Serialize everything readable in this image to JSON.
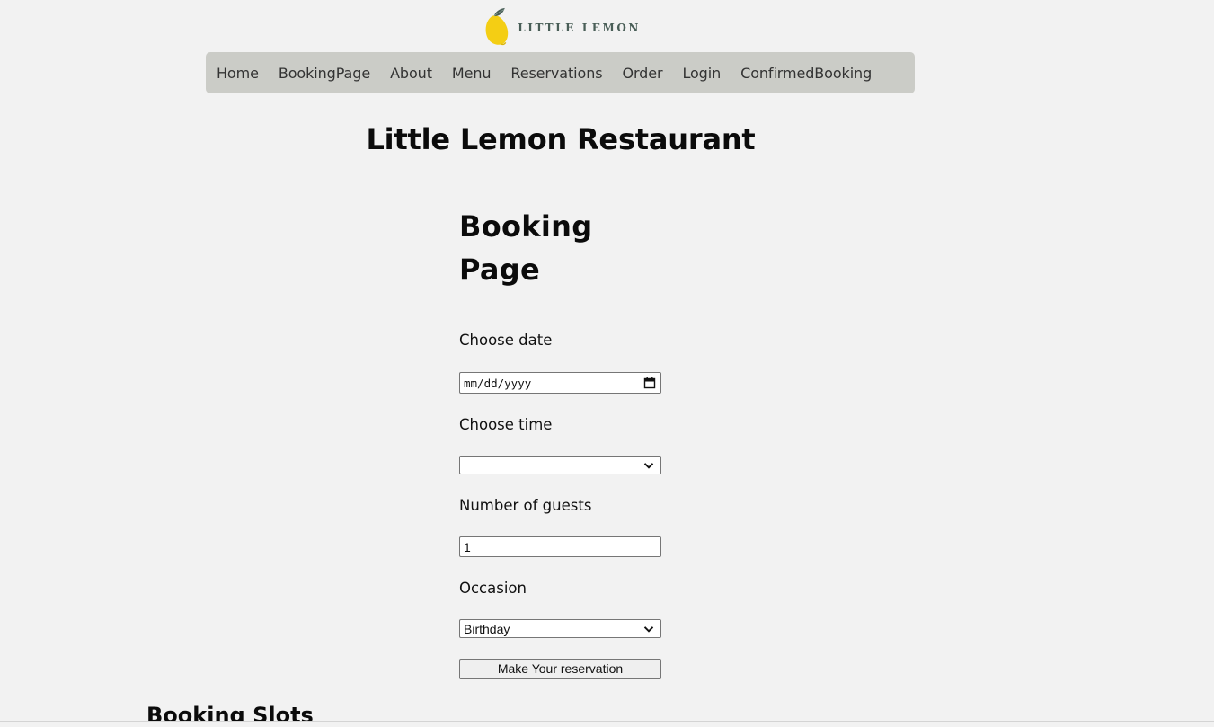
{
  "logo": {
    "text": "LITTLE LEMON",
    "icon": "lemon-icon",
    "colors": {
      "lemon": "#f4ce14",
      "leaf": "#495e57",
      "text": "#495e57"
    }
  },
  "nav": {
    "items": [
      {
        "label": "Home"
      },
      {
        "label": "BookingPage"
      },
      {
        "label": "About"
      },
      {
        "label": "Menu"
      },
      {
        "label": "Reservations"
      },
      {
        "label": "Order"
      },
      {
        "label": "Login"
      },
      {
        "label": "ConfirmedBooking"
      }
    ]
  },
  "header": {
    "title": "Little Lemon Restaurant"
  },
  "booking": {
    "title": "Booking Page",
    "date": {
      "label": "Choose date",
      "placeholder": "mm/dd/yyyy",
      "icon": "calendar-icon"
    },
    "time": {
      "label": "Choose time",
      "value": "",
      "icon": "chevron-down-icon"
    },
    "guests": {
      "label": "Number of guests",
      "value": "1"
    },
    "occasion": {
      "label": "Occasion",
      "value": "Birthday",
      "icon": "chevron-down-icon"
    },
    "submit_label": "Make Your reservation"
  },
  "slots": {
    "title": "Booking Slots"
  },
  "colors": {
    "background": "#f2f2f2",
    "nav_background": "#cbccc7"
  }
}
